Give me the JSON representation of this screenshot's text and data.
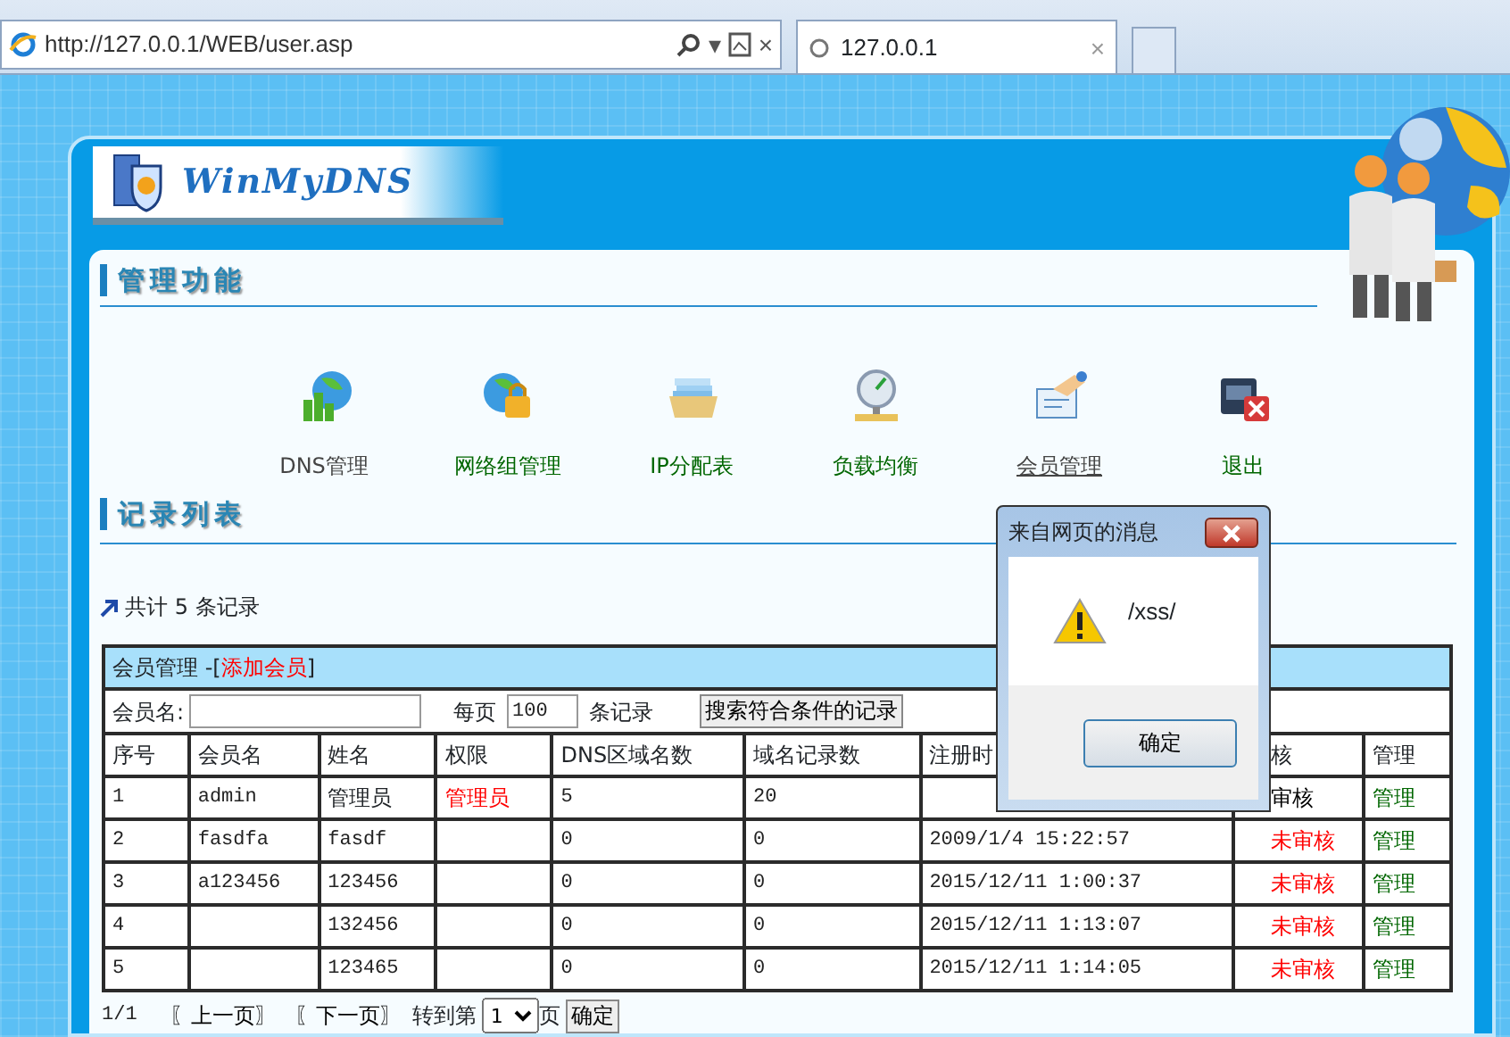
{
  "browser": {
    "address": "http://127.0.0.1/WEB/user.asp",
    "tab_title": "127.0.0.1",
    "tab_close": "×",
    "address_close": "×",
    "address_caret": "▾"
  },
  "site": {
    "logo_text": "WinMyDNS",
    "section_title": "管理功能",
    "list_title": "记录列表"
  },
  "nav": [
    {
      "label": "DNS管理",
      "visited": true,
      "selected": false
    },
    {
      "label": "网络组管理",
      "visited": false,
      "selected": false
    },
    {
      "label": "IP分配表",
      "visited": false,
      "selected": false
    },
    {
      "label": "负载均衡",
      "visited": false,
      "selected": false
    },
    {
      "label": "会员管理",
      "visited": true,
      "selected": true
    },
    {
      "label": "退出",
      "visited": false,
      "selected": false
    }
  ],
  "summary": {
    "prefix": "共计",
    "count": "5",
    "suffix": "条记录"
  },
  "table": {
    "title": "会员管理 -[",
    "add_link": "添加会员",
    "title_end": "]",
    "search": {
      "name_label": "会员名:",
      "per_page_label": "每页",
      "per_page_value": "100",
      "records_label": "条记录",
      "button": "搜索符合条件的记录"
    },
    "columns": [
      "序号",
      "会员名",
      "姓名",
      "权限",
      "DNS区域名数",
      "域名记录数",
      "注册时",
      "核",
      "管理"
    ],
    "rows": [
      {
        "cells": [
          "1",
          "admin",
          "管理员",
          "管理员",
          "5",
          "20",
          ""
        ],
        "status": "审核",
        "color": "#000000",
        "action": "管理"
      },
      {
        "cells": [
          "2",
          "fasdfa",
          "fasdf",
          "",
          "0",
          "0",
          "2009/1/4 15:22:57"
        ],
        "status": "未审核",
        "color": "#ff0000",
        "action": "管理"
      },
      {
        "cells": [
          "3",
          "a123456",
          "123456",
          "",
          "0",
          "0",
          "2015/12/11 1:00:37"
        ],
        "status": "未审核",
        "color": "#ff0000",
        "action": "管理"
      },
      {
        "cells": [
          "4",
          "",
          "132456",
          "",
          "0",
          "0",
          "2015/12/11 1:13:07"
        ],
        "status": "未审核",
        "color": "#ff0000",
        "action": "管理"
      },
      {
        "cells": [
          "5",
          "",
          "123465",
          "",
          "0",
          "0",
          "2015/12/11 1:14:05"
        ],
        "status": "未审核",
        "color": "#ff0000",
        "action": "管理"
      }
    ]
  },
  "pager": {
    "position": "1/1",
    "prev": "〖上一页〗",
    "next": "〖下一页〗",
    "goto_label": "转到第",
    "page_value": "1",
    "page_suffix": "页",
    "go_button": "确定"
  },
  "dialog": {
    "title": "来自网页的消息",
    "message": "/xss/",
    "ok": "确定"
  }
}
